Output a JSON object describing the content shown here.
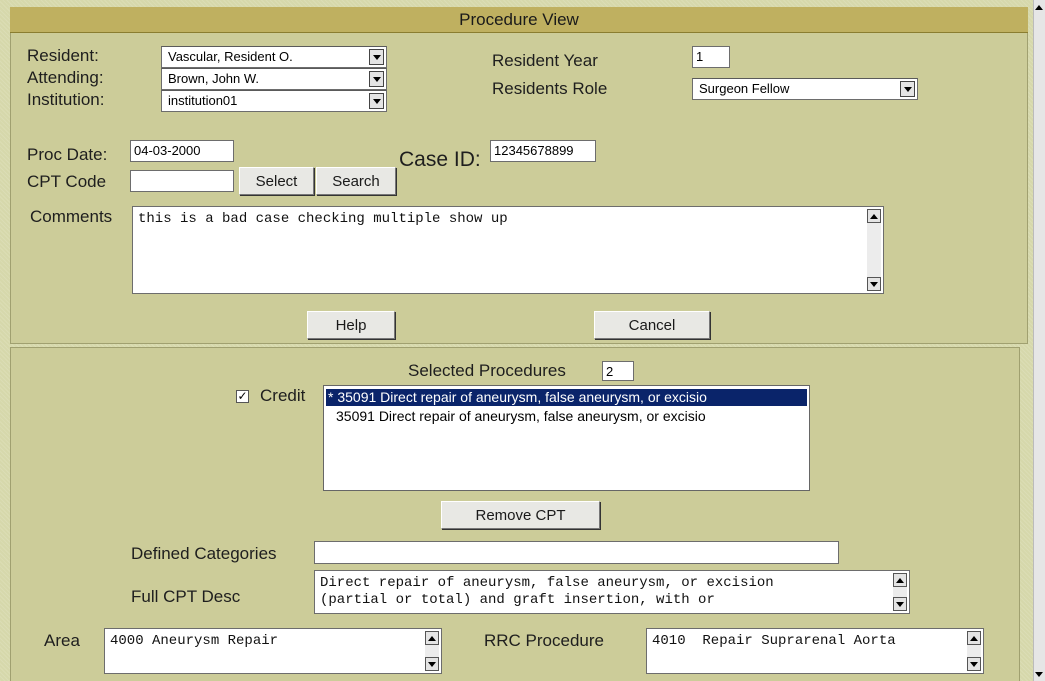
{
  "window": {
    "title": "Procedure View"
  },
  "form": {
    "resident_label": "Resident:",
    "resident_value": "Vascular, Resident O.",
    "attending_label": "Attending:",
    "attending_value": "Brown, John W.",
    "institution_label": "Institution:",
    "institution_value": "institution01",
    "resident_year_label": "Resident Year",
    "resident_year_value": "1",
    "residents_role_label": "Residents Role",
    "residents_role_value": "Surgeon Fellow",
    "proc_date_label": "Proc Date:",
    "proc_date_value": "04-03-2000",
    "case_id_label": "Case ID:",
    "case_id_value": "12345678899",
    "cpt_code_label": "CPT Code",
    "cpt_code_value": "",
    "select_label": "Select",
    "search_label": "Search",
    "comments_label": "Comments",
    "comments_value": "this is a bad case checking multiple show up",
    "help_label": "Help",
    "cancel_label": "Cancel"
  },
  "procedures": {
    "selected_label": "Selected Procedures",
    "selected_count": "2",
    "credit_label": "Credit",
    "credit_checked": true,
    "check_mark": "✓",
    "items": [
      {
        "text": "* 35091 Direct repair of aneurysm, false aneurysm, or excisio",
        "selected": true
      },
      {
        "text": "35091 Direct repair of aneurysm, false aneurysm, or excisio",
        "selected": false
      }
    ],
    "remove_cpt_label": "Remove CPT",
    "defined_categories_label": "Defined Categories",
    "defined_categories_value": "",
    "full_cpt_desc_label": "Full CPT Desc",
    "full_cpt_desc_line1": "Direct repair of aneurysm, false aneurysm, or excision",
    "full_cpt_desc_line2": "(partial or total) and graft insertion, with or",
    "area_label": "Area",
    "area_value": "4000 Aneurysm Repair",
    "rrc_label": "RRC Procedure",
    "rrc_value": "4010  Repair Suprarenal Aorta"
  },
  "colors": {
    "panel": "#cccc99",
    "titlebar": "#bfb060",
    "selection": "#0a246a"
  }
}
